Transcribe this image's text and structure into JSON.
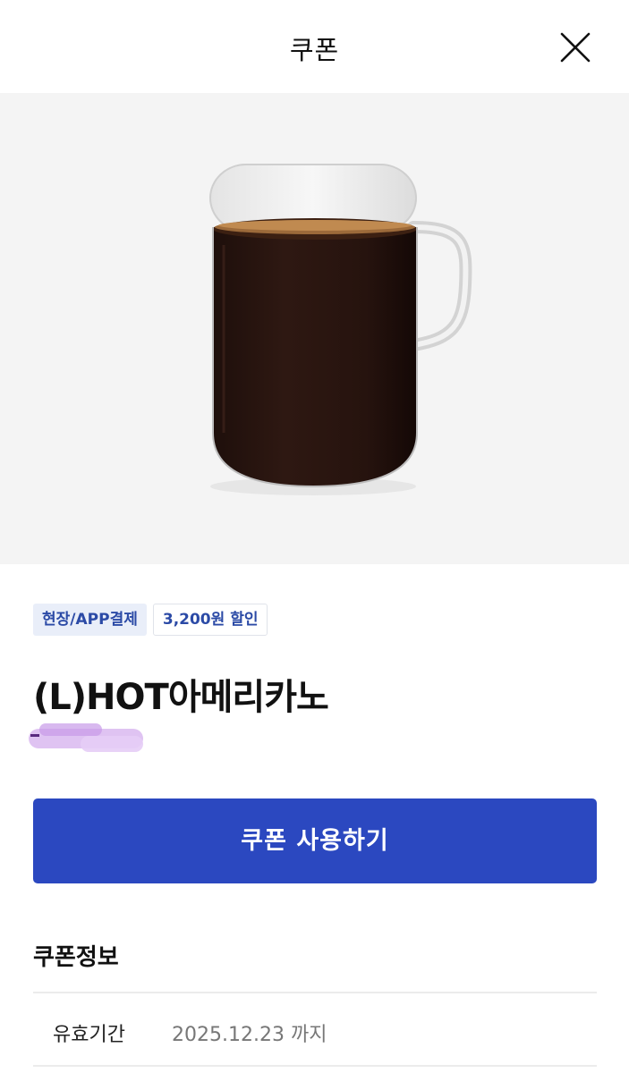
{
  "header": {
    "title": "쿠폰",
    "close_icon": "close-icon"
  },
  "hero": {
    "image_subject": "hot-americano-glass-mug",
    "background_color": "#f4f4f4"
  },
  "tags": [
    {
      "label": "현장/APP결제"
    },
    {
      "label": "3,200원 할인"
    }
  ],
  "product": {
    "name": "(L)HOT아메리카노"
  },
  "actions": {
    "use_coupon_label": "쿠폰 사용하기",
    "accent_color": "#2b48c0"
  },
  "info_section": {
    "title": "쿠폰정보",
    "rows": [
      {
        "label": "유효기간",
        "value": "2025.12.23 까지"
      }
    ]
  }
}
